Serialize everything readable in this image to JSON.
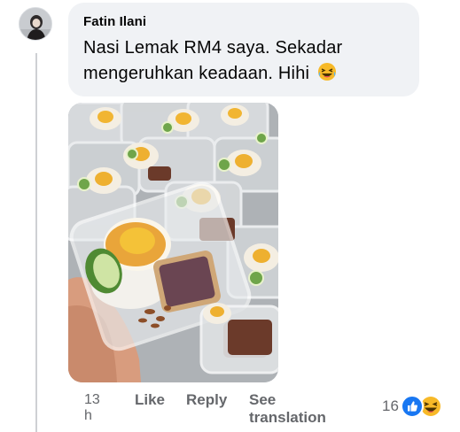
{
  "comment": {
    "author": "Fatin Ilani",
    "text_line1": "Nasi Lemak RM4 saya. Sekadar",
    "text_line2": "mengeruhkan keadaan. Hihi",
    "emoji": "laughing-face-icon"
  },
  "actions": {
    "time": "13 h",
    "like": "Like",
    "reply": "Reply",
    "see_translation_line1": "See",
    "see_translation_line2": "translation"
  },
  "reactions": {
    "count": "16",
    "icons": [
      "like-icon",
      "haha-icon"
    ]
  },
  "colors": {
    "bubble": "#f0f2f5",
    "secondary_text": "#65676b",
    "like_blue": "#1877f2"
  }
}
